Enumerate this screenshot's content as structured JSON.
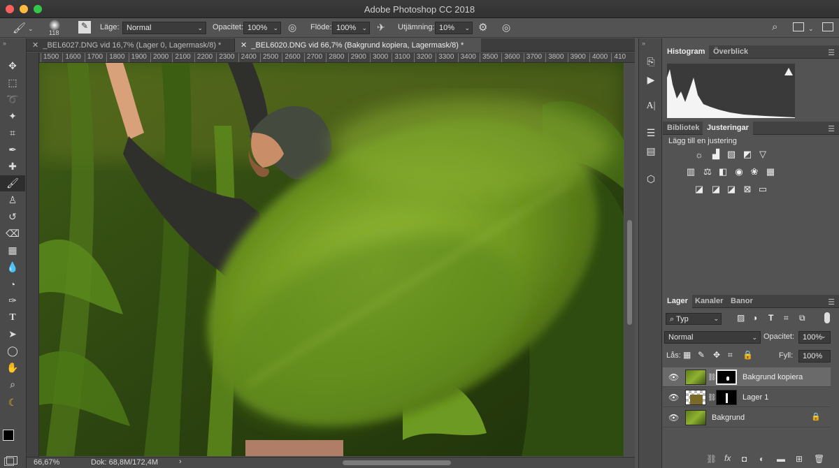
{
  "window": {
    "title": "Adobe Photoshop CC 2018"
  },
  "options": {
    "brush_size": "118",
    "mode_label": "Läge:",
    "mode_value": "Normal",
    "opacity_label": "Opacitet:",
    "opacity_value": "100%",
    "flow_label": "Flöde:",
    "flow_value": "100%",
    "smoothing_label": "Utjämning:",
    "smoothing_value": "10%"
  },
  "tabs": [
    {
      "label": "_BEL6027.DNG vid 16,7% (Lager 0, Lagermask/8) *"
    },
    {
      "label": "_BEL6020.DNG vid 66,7% (Bakgrund kopiera, Lagermask/8) *"
    }
  ],
  "ruler": [
    "1500",
    "1600",
    "1700",
    "1800",
    "1900",
    "2000",
    "2100",
    "2200",
    "2300",
    "2400",
    "2500",
    "2600",
    "2700",
    "2800",
    "2900",
    "3000",
    "3100",
    "3200",
    "3300",
    "3400",
    "3500",
    "3600",
    "3700",
    "3800",
    "3900",
    "4000",
    "410"
  ],
  "status": {
    "zoom": "66,67%",
    "doc": "Dok: 68,8M/172,4M"
  },
  "histogram_panel": {
    "tabs": [
      "Histogram",
      "Överblick"
    ]
  },
  "adjust_panel": {
    "tabs": [
      "Bibliotek",
      "Justeringar"
    ],
    "heading": "Lägg till en justering"
  },
  "layers_panel": {
    "tabs": [
      "Lager",
      "Kanaler",
      "Banor"
    ],
    "filter_value": "Typ",
    "blend_mode": "Normal",
    "opacity_label": "Opacitet:",
    "opacity_value": "100%",
    "lock_label": "Lås:",
    "fill_label": "Fyll:",
    "fill_value": "100%",
    "layers": [
      {
        "name": "Bakgrund kopiera",
        "selected": true
      },
      {
        "name": "Lager 1",
        "selected": false
      },
      {
        "name": "Bakgrund",
        "selected": false
      }
    ]
  },
  "colors": {
    "accent": "#2d7ff9",
    "panel_bg": "#535353"
  }
}
